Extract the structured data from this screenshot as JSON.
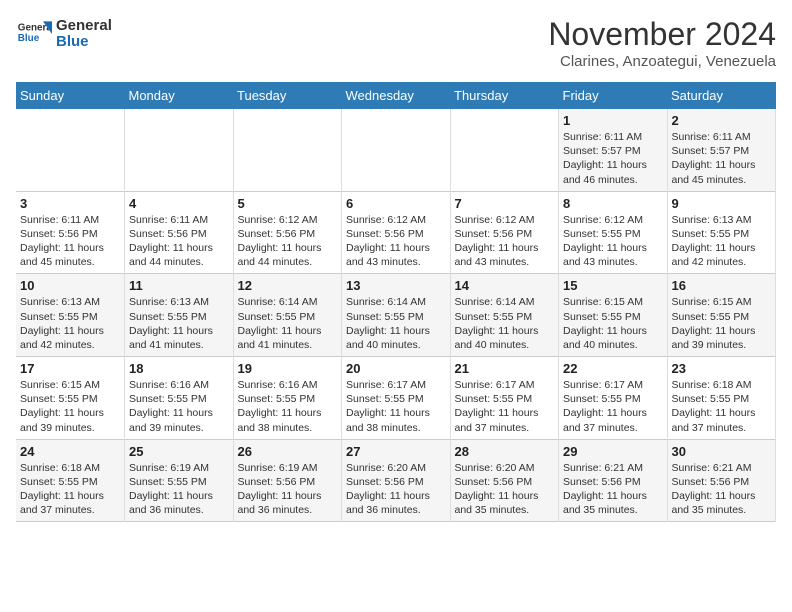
{
  "header": {
    "logo_line1": "General",
    "logo_line2": "Blue",
    "month": "November 2024",
    "location": "Clarines, Anzoategui, Venezuela"
  },
  "weekdays": [
    "Sunday",
    "Monday",
    "Tuesday",
    "Wednesday",
    "Thursday",
    "Friday",
    "Saturday"
  ],
  "weeks": [
    [
      {
        "day": "",
        "info": ""
      },
      {
        "day": "",
        "info": ""
      },
      {
        "day": "",
        "info": ""
      },
      {
        "day": "",
        "info": ""
      },
      {
        "day": "",
        "info": ""
      },
      {
        "day": "1",
        "info": "Sunrise: 6:11 AM\nSunset: 5:57 PM\nDaylight: 11 hours and 46 minutes."
      },
      {
        "day": "2",
        "info": "Sunrise: 6:11 AM\nSunset: 5:57 PM\nDaylight: 11 hours and 45 minutes."
      }
    ],
    [
      {
        "day": "3",
        "info": "Sunrise: 6:11 AM\nSunset: 5:56 PM\nDaylight: 11 hours and 45 minutes."
      },
      {
        "day": "4",
        "info": "Sunrise: 6:11 AM\nSunset: 5:56 PM\nDaylight: 11 hours and 44 minutes."
      },
      {
        "day": "5",
        "info": "Sunrise: 6:12 AM\nSunset: 5:56 PM\nDaylight: 11 hours and 44 minutes."
      },
      {
        "day": "6",
        "info": "Sunrise: 6:12 AM\nSunset: 5:56 PM\nDaylight: 11 hours and 43 minutes."
      },
      {
        "day": "7",
        "info": "Sunrise: 6:12 AM\nSunset: 5:56 PM\nDaylight: 11 hours and 43 minutes."
      },
      {
        "day": "8",
        "info": "Sunrise: 6:12 AM\nSunset: 5:55 PM\nDaylight: 11 hours and 43 minutes."
      },
      {
        "day": "9",
        "info": "Sunrise: 6:13 AM\nSunset: 5:55 PM\nDaylight: 11 hours and 42 minutes."
      }
    ],
    [
      {
        "day": "10",
        "info": "Sunrise: 6:13 AM\nSunset: 5:55 PM\nDaylight: 11 hours and 42 minutes."
      },
      {
        "day": "11",
        "info": "Sunrise: 6:13 AM\nSunset: 5:55 PM\nDaylight: 11 hours and 41 minutes."
      },
      {
        "day": "12",
        "info": "Sunrise: 6:14 AM\nSunset: 5:55 PM\nDaylight: 11 hours and 41 minutes."
      },
      {
        "day": "13",
        "info": "Sunrise: 6:14 AM\nSunset: 5:55 PM\nDaylight: 11 hours and 40 minutes."
      },
      {
        "day": "14",
        "info": "Sunrise: 6:14 AM\nSunset: 5:55 PM\nDaylight: 11 hours and 40 minutes."
      },
      {
        "day": "15",
        "info": "Sunrise: 6:15 AM\nSunset: 5:55 PM\nDaylight: 11 hours and 40 minutes."
      },
      {
        "day": "16",
        "info": "Sunrise: 6:15 AM\nSunset: 5:55 PM\nDaylight: 11 hours and 39 minutes."
      }
    ],
    [
      {
        "day": "17",
        "info": "Sunrise: 6:15 AM\nSunset: 5:55 PM\nDaylight: 11 hours and 39 minutes."
      },
      {
        "day": "18",
        "info": "Sunrise: 6:16 AM\nSunset: 5:55 PM\nDaylight: 11 hours and 39 minutes."
      },
      {
        "day": "19",
        "info": "Sunrise: 6:16 AM\nSunset: 5:55 PM\nDaylight: 11 hours and 38 minutes."
      },
      {
        "day": "20",
        "info": "Sunrise: 6:17 AM\nSunset: 5:55 PM\nDaylight: 11 hours and 38 minutes."
      },
      {
        "day": "21",
        "info": "Sunrise: 6:17 AM\nSunset: 5:55 PM\nDaylight: 11 hours and 37 minutes."
      },
      {
        "day": "22",
        "info": "Sunrise: 6:17 AM\nSunset: 5:55 PM\nDaylight: 11 hours and 37 minutes."
      },
      {
        "day": "23",
        "info": "Sunrise: 6:18 AM\nSunset: 5:55 PM\nDaylight: 11 hours and 37 minutes."
      }
    ],
    [
      {
        "day": "24",
        "info": "Sunrise: 6:18 AM\nSunset: 5:55 PM\nDaylight: 11 hours and 37 minutes."
      },
      {
        "day": "25",
        "info": "Sunrise: 6:19 AM\nSunset: 5:55 PM\nDaylight: 11 hours and 36 minutes."
      },
      {
        "day": "26",
        "info": "Sunrise: 6:19 AM\nSunset: 5:56 PM\nDaylight: 11 hours and 36 minutes."
      },
      {
        "day": "27",
        "info": "Sunrise: 6:20 AM\nSunset: 5:56 PM\nDaylight: 11 hours and 36 minutes."
      },
      {
        "day": "28",
        "info": "Sunrise: 6:20 AM\nSunset: 5:56 PM\nDaylight: 11 hours and 35 minutes."
      },
      {
        "day": "29",
        "info": "Sunrise: 6:21 AM\nSunset: 5:56 PM\nDaylight: 11 hours and 35 minutes."
      },
      {
        "day": "30",
        "info": "Sunrise: 6:21 AM\nSunset: 5:56 PM\nDaylight: 11 hours and 35 minutes."
      }
    ]
  ]
}
